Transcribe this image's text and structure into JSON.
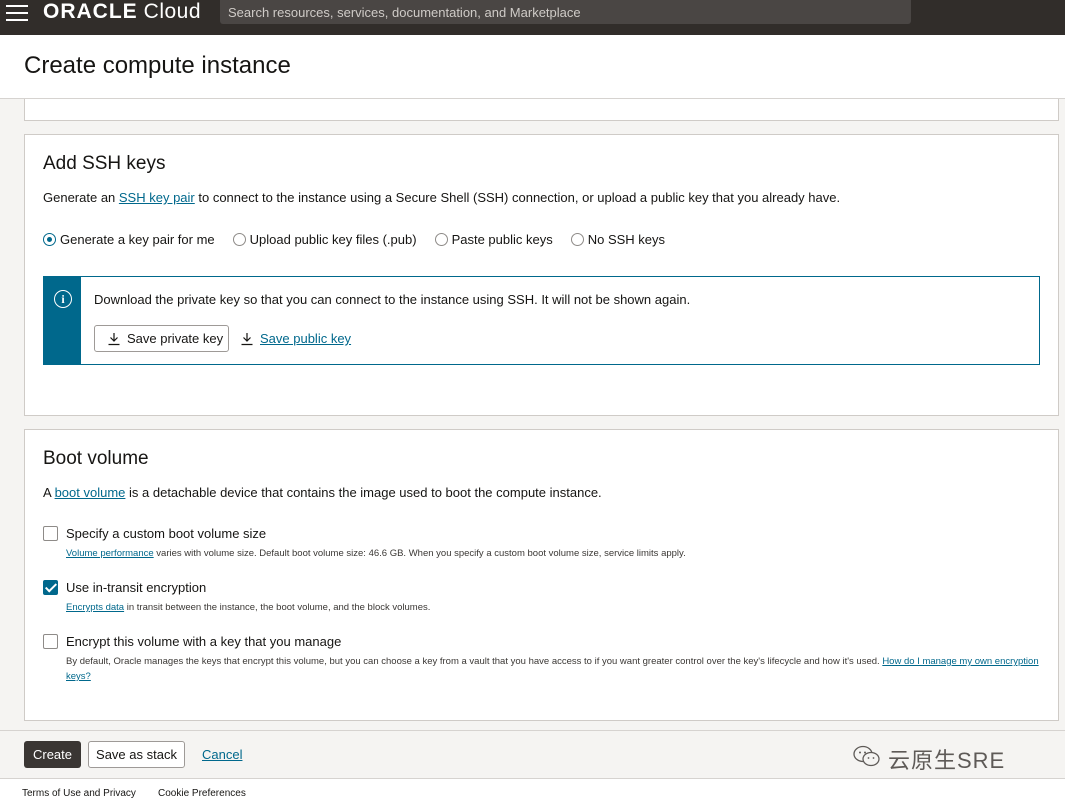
{
  "topbar": {
    "brand_oracle": "ORACLE",
    "brand_cloud": "Cloud",
    "search_placeholder": "Search resources, services, documentation, and Marketplace"
  },
  "page": {
    "title": "Create compute instance"
  },
  "ssh": {
    "heading": "Add SSH keys",
    "desc_prefix": "Generate an ",
    "desc_link": "SSH key pair",
    "desc_suffix": " to connect to the instance using a Secure Shell (SSH) connection, or upload a public key that you already have.",
    "options": [
      {
        "label": "Generate a key pair for me",
        "selected": true
      },
      {
        "label": "Upload public key files (.pub)",
        "selected": false
      },
      {
        "label": "Paste public keys",
        "selected": false
      },
      {
        "label": "No SSH keys",
        "selected": false
      }
    ],
    "info_text": "Download the private key so that you can connect to the instance using SSH. It will not be shown again.",
    "save_private": "Save private key",
    "save_public": "Save public key"
  },
  "boot": {
    "heading": "Boot volume",
    "desc_prefix": "A ",
    "desc_link": "boot volume",
    "desc_suffix": " is a detachable device that contains the image used to boot the compute instance.",
    "options": [
      {
        "label": "Specify a custom boot volume size",
        "checked": false,
        "help_link": "Volume performance",
        "help_text": " varies with volume size. Default boot volume size: 46.6 GB. When you specify a custom boot volume size, service limits apply."
      },
      {
        "label": "Use in-transit encryption",
        "checked": true,
        "help_link": "Encrypts data",
        "help_text": " in transit between the instance, the boot volume, and the block volumes."
      },
      {
        "label": "Encrypt this volume with a key that you manage",
        "checked": false,
        "help_text": "By default, Oracle manages the keys that encrypt this volume, but you can choose a key from a vault that you have access to if you want greater control over the key's lifecycle and how it's used. ",
        "help_link": "How do I manage my own encryption keys?"
      }
    ]
  },
  "actions": {
    "create": "Create",
    "save_stack": "Save as stack",
    "cancel": "Cancel"
  },
  "watermark": "云原生SRE",
  "footer": {
    "terms": "Terms of Use and Privacy",
    "cookies": "Cookie Preferences"
  },
  "colors": {
    "accent": "#00688c",
    "topbar": "#312d2a",
    "primary_button": "#3a3633"
  }
}
